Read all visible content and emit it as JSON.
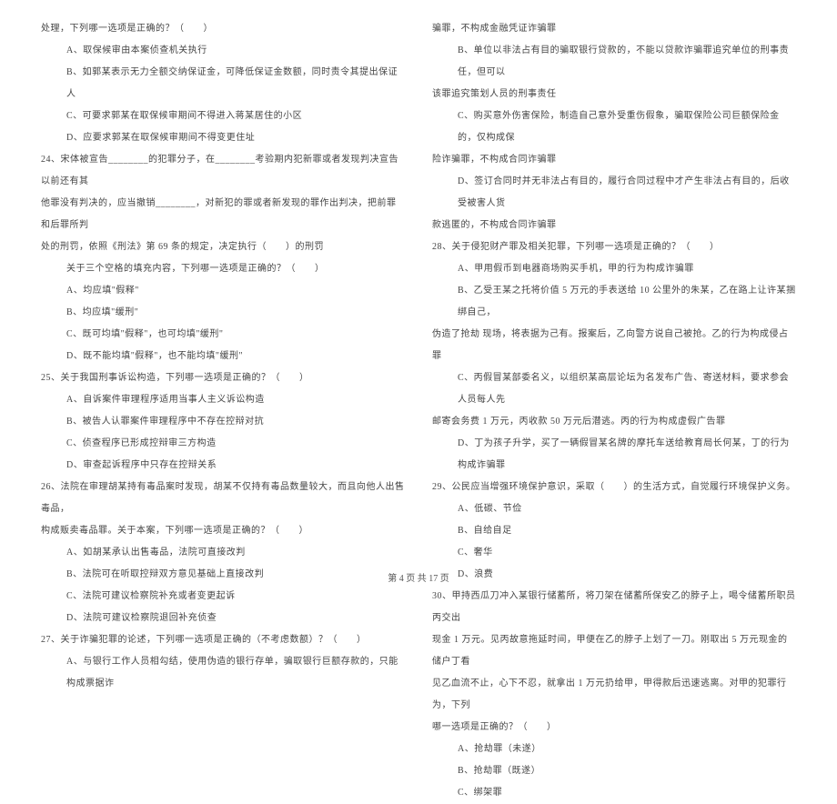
{
  "left_column": [
    {
      "indent": 1,
      "text": "处理，下列哪一选项是正确的？（　　）"
    },
    {
      "indent": 2,
      "text": "A、取保候审由本案侦查机关执行"
    },
    {
      "indent": 2,
      "text": "B、如郭某表示无力全额交纳保证金，可降低保证金数额，同时责令其提出保证人"
    },
    {
      "indent": 2,
      "text": "C、可要求郭某在取保候审期间不得进入蒋某居住的小区"
    },
    {
      "indent": 2,
      "text": "D、应要求郭某在取保候审期间不得变更住址"
    },
    {
      "indent": 1,
      "text": "24、宋体被宣告________的犯罪分子，在________考验期内犯新罪或者发现判决宣告以前还有其"
    },
    {
      "indent": 1,
      "text": "他罪没有判决的，应当撤销________，对新犯的罪或者新发现的罪作出判决，把前罪和后罪所判"
    },
    {
      "indent": 1,
      "text": "处的刑罚，依照《刑法》第 69 条的规定，决定执行（　　）的刑罚"
    },
    {
      "indent": 2,
      "text": "关于三个空格的填充内容，下列哪一选项是正确的？（　　）"
    },
    {
      "indent": 2,
      "text": "A、均应填\"假释\""
    },
    {
      "indent": 2,
      "text": "B、均应填\"缓刑\""
    },
    {
      "indent": 2,
      "text": "C、既可均填\"假释\"，也可均填\"缓刑\""
    },
    {
      "indent": 2,
      "text": "D、既不能均填\"假释\"，也不能均填\"缓刑\""
    },
    {
      "indent": 1,
      "text": "25、关于我国刑事诉讼构造，下列哪一选项是正确的？（　　）"
    },
    {
      "indent": 2,
      "text": "A、自诉案件审理程序适用当事人主义诉讼构造"
    },
    {
      "indent": 2,
      "text": "B、被告人认罪案件审理程序中不存在控辩对抗"
    },
    {
      "indent": 2,
      "text": "C、侦查程序已形成控辩审三方构造"
    },
    {
      "indent": 2,
      "text": "D、审查起诉程序中只存在控辩关系"
    },
    {
      "indent": 1,
      "text": "26、法院在审理胡某持有毒品案时发现，胡某不仅持有毒品数量较大，而且向他人出售毒品，"
    },
    {
      "indent": 1,
      "text": "构成贩卖毒品罪。关于本案，下列哪一选项是正确的？（　　）"
    },
    {
      "indent": 2,
      "text": "A、如胡某承认出售毒品，法院可直接改判"
    },
    {
      "indent": 2,
      "text": "B、法院可在听取控辩双方意见基础上直接改判"
    },
    {
      "indent": 2,
      "text": "C、法院可建议检察院补充或者变更起诉"
    },
    {
      "indent": 2,
      "text": "D、法院可建议检察院退回补充侦查"
    },
    {
      "indent": 1,
      "text": "27、关于诈骗犯罪的论述，下列哪一选项是正确的（不考虑数额）？（　　）"
    },
    {
      "indent": 2,
      "text": "A、与银行工作人员相勾结，使用伪造的银行存单，骗取银行巨额存款的，只能构成票据诈"
    }
  ],
  "right_column": [
    {
      "indent": 1,
      "text": "骗罪，不构成金融凭证诈骗罪"
    },
    {
      "indent": 2,
      "text": "B、单位以非法占有目的骗取银行贷款的，不能以贷款诈骗罪追究单位的刑事责任，但可以"
    },
    {
      "indent": 1,
      "text": "该罪追究策划人员的刑事责任"
    },
    {
      "indent": 2,
      "text": "C、购买意外伤害保险，制造自己意外受重伤假象，骗取保险公司巨额保险金的，仅构成保"
    },
    {
      "indent": 1,
      "text": "险诈骗罪，不构成合同诈骗罪"
    },
    {
      "indent": 2,
      "text": "D、签订合同时并无非法占有目的，履行合同过程中才产生非法占有目的，后收受被害人货"
    },
    {
      "indent": 1,
      "text": "款逃匿的，不构成合同诈骗罪"
    },
    {
      "indent": 1,
      "text": "28、关于侵犯财产罪及相关犯罪，下列哪一选项是正确的？（　　）"
    },
    {
      "indent": 2,
      "text": "A、甲用假币到电器商场购买手机，甲的行为构成诈骗罪"
    },
    {
      "indent": 2,
      "text": "B、乙受王某之托将价值 5 万元的手表送给 10 公里外的朱某，乙在路上让许某捆绑自己，"
    },
    {
      "indent": 1,
      "text": "伪造了抢劫 现场，将表据为己有。报案后，乙向警方说自己被抢。乙的行为构成侵占罪"
    },
    {
      "indent": 2,
      "text": "C、丙假冒某部委名义，以组织某高层论坛为名发布广告、寄送材料，要求参会人员每人先"
    },
    {
      "indent": 1,
      "text": "邮寄会务费 1 万元，丙收款 50 万元后潜逃。丙的行为构成虚假广告罪"
    },
    {
      "indent": 2,
      "text": "D、丁为孩子升学，买了一辆假冒某名牌的摩托车送给教育局长何某，丁的行为构成诈骗罪"
    },
    {
      "indent": 1,
      "text": "29、公民应当增强环境保护意识，采取（　　）的生活方式，自觉履行环境保护义务。"
    },
    {
      "indent": 2,
      "text": "A、低碳、节俭"
    },
    {
      "indent": 2,
      "text": "B、自给自足"
    },
    {
      "indent": 2,
      "text": "C、奢华"
    },
    {
      "indent": 2,
      "text": "D、浪费"
    },
    {
      "indent": 1,
      "text": "30、甲持西瓜刀冲入某银行储蓄所，将刀架在储蓄所保安乙的脖子上，喝令储蓄所职员丙交出"
    },
    {
      "indent": 1,
      "text": "现金 1 万元。见丙故意拖延时间，甲便在乙的脖子上划了一刀。刚取出 5 万元现金的储户丁看"
    },
    {
      "indent": 1,
      "text": "见乙血流不止，心下不忍，就拿出 1 万元扔给甲，甲得款后迅速逃离。对甲的犯罪行为，下列"
    },
    {
      "indent": 1,
      "text": "哪一选项是正确的？（　　）"
    },
    {
      "indent": 2,
      "text": "A、抢劫罪（未遂）"
    },
    {
      "indent": 2,
      "text": "B、抢劫罪（既遂）"
    },
    {
      "indent": 2,
      "text": "C、绑架罪"
    }
  ],
  "footer": "第 4 页 共 17 页"
}
